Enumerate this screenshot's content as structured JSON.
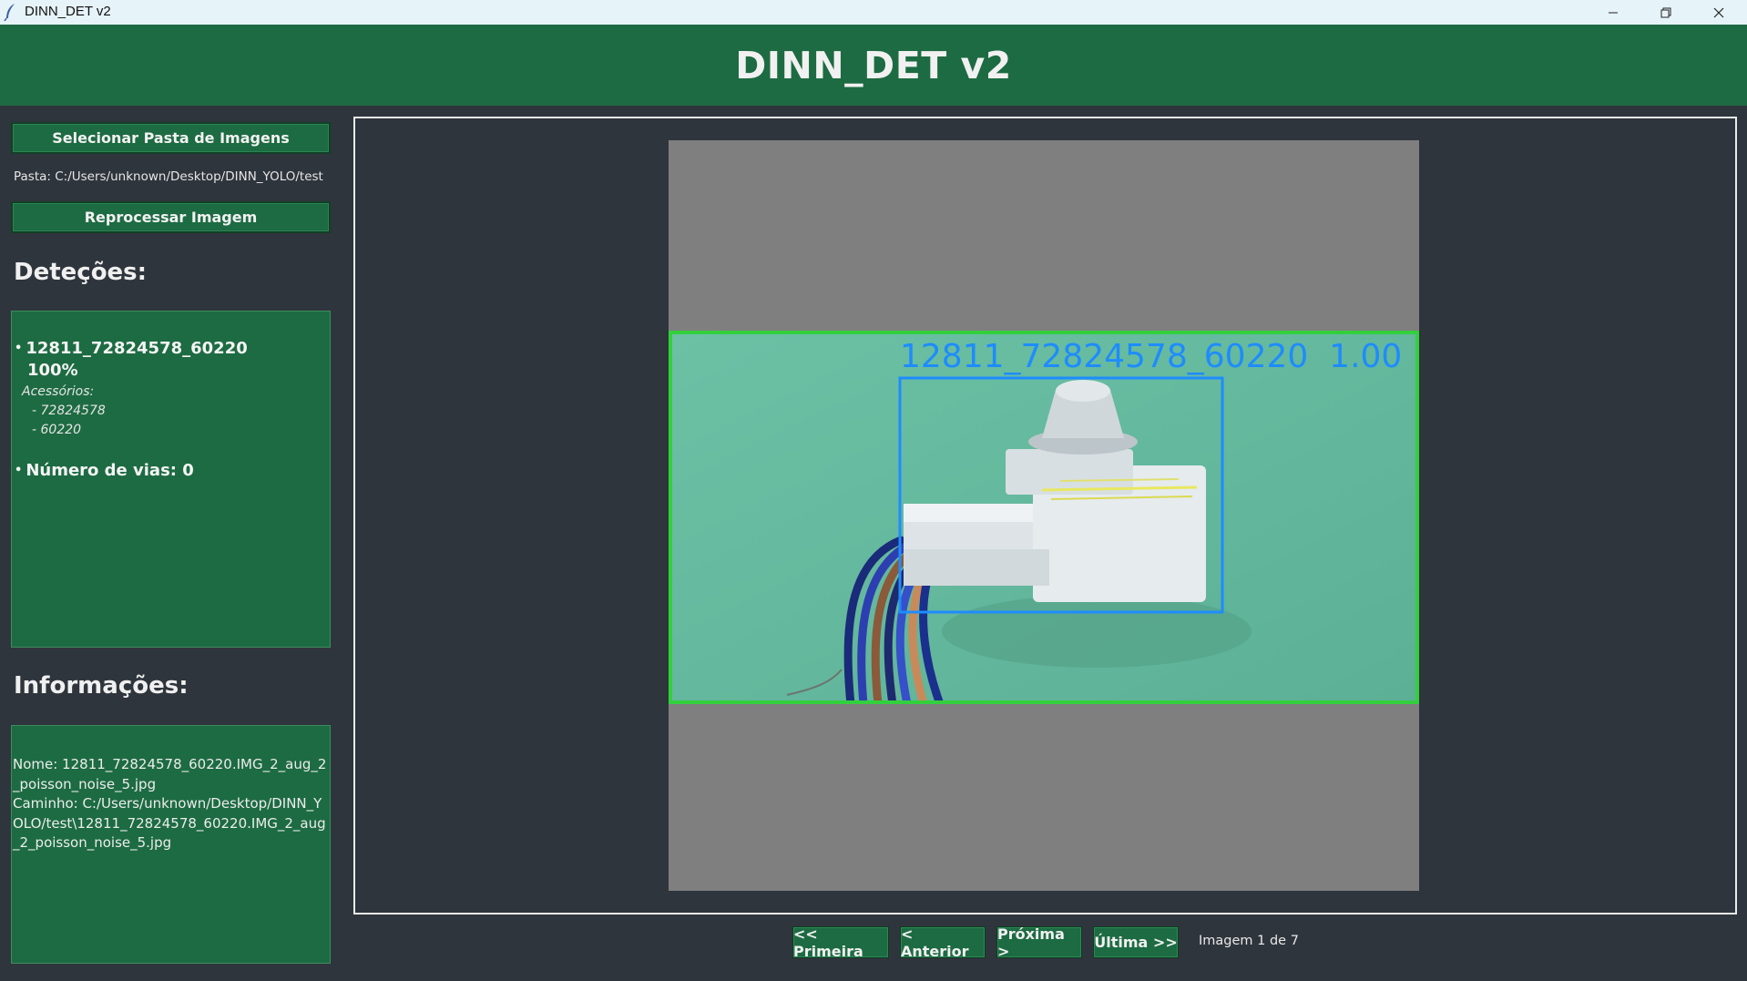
{
  "window": {
    "title": "DINN_DET v2",
    "icon": "feather-icon",
    "controls": [
      "minimize-icon",
      "restore-icon",
      "close-icon"
    ]
  },
  "header": {
    "title": "DINN_DET v2"
  },
  "sidebar": {
    "select_folder_label": "Selecionar Pasta de Imagens",
    "folder_path": "Pasta: C:/Users/unknown/Desktop/DINN_YOLO/test",
    "reprocess_label": "Reprocessar Imagem",
    "detections_title": "Deteções:",
    "detections": {
      "class_name": "12811_72824578_60220",
      "confidence": "100%",
      "accessories_label": "Acessórios:",
      "accessories": [
        "- 72824578",
        "- 60220"
      ],
      "vias": "Número de vias: 0"
    },
    "info_title": "Informações:",
    "info": {
      "name": "Nome: 12811_72824578_60220.IMG_2_aug_2_poisson_noise_5.jpg",
      "path": "Caminho: C:/Users/unknown/Desktop/DINN_YOLO/test\\12811_72824578_60220.IMG_2_aug_2_poisson_noise_5.jpg"
    }
  },
  "viewer": {
    "box_label": "12811_72824578_60220  1.00"
  },
  "navigation": {
    "first_label": "<< Primeira",
    "prev_label": "< Anterior",
    "next_label": "Próxima >",
    "last_label": "Última >>",
    "counter": "Imagem 1 de 7"
  },
  "colors": {
    "header_green": "#1d6b42",
    "background": "#2f353c",
    "detection_box": "#1e8cff",
    "image_border": "#33d03d"
  }
}
